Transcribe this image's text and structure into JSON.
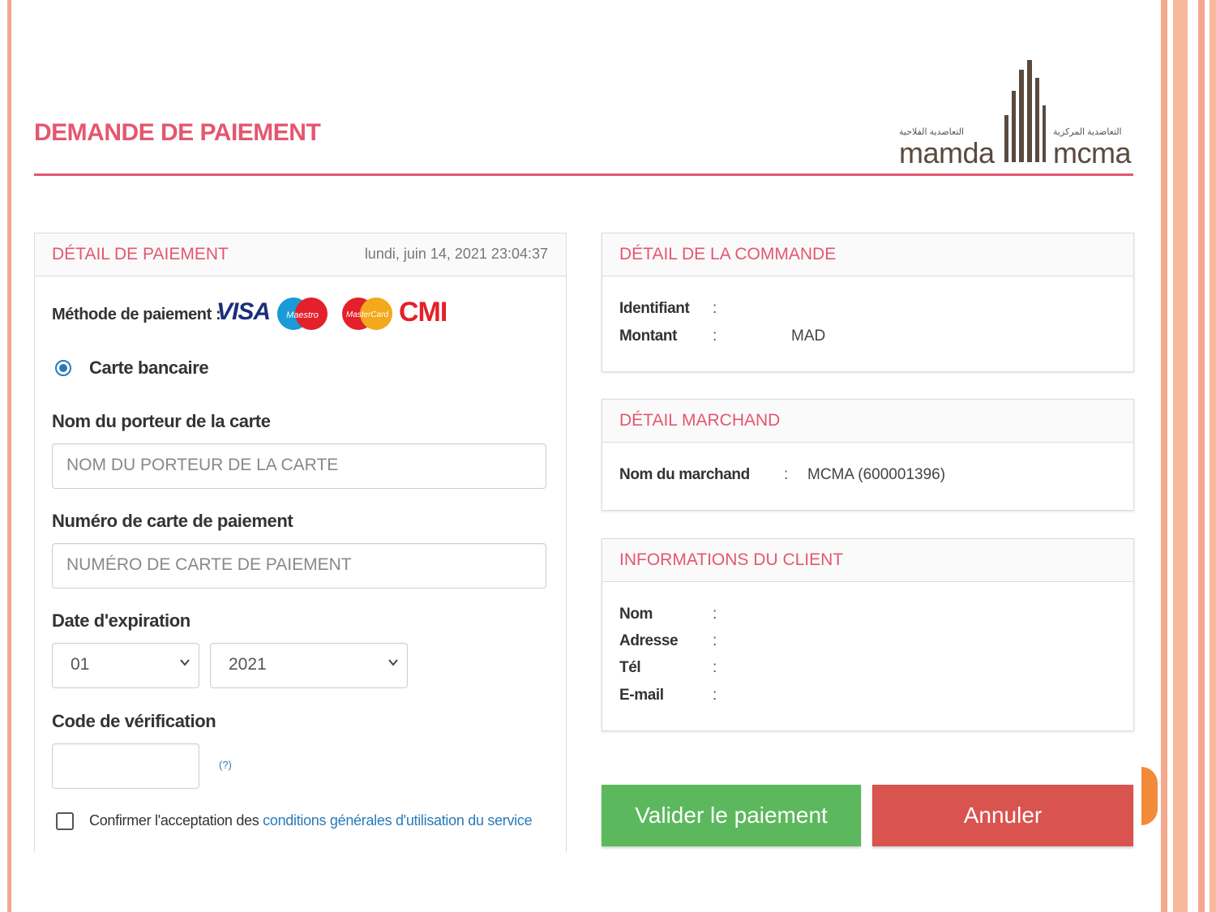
{
  "header": {
    "title": "DEMANDE DE PAIEMENT",
    "logo": {
      "left_word": "mamda",
      "right_word": "mcma",
      "left_arabic": "التعاضدية الفلاحية",
      "right_arabic": "التعاضدية المركزية"
    }
  },
  "payment_panel": {
    "title": "DÉTAIL DE PAIEMENT",
    "date": "lundi, juin 14, 2021 23:04:37",
    "method_label": "Méthode de paiement :",
    "brands": {
      "visa": "VISA",
      "maestro": "Maestro",
      "mastercard": "MasterCard",
      "cmi": "CMI"
    },
    "radio_label": "Carte bancaire",
    "holder_label": "Nom du porteur de la carte",
    "holder_placeholder": "NOM DU PORTEUR DE LA CARTE",
    "number_label": "Numéro de carte de paiement",
    "number_placeholder": "NUMÉRO DE CARTE DE PAIEMENT",
    "expiry_label": "Date d'expiration",
    "expiry_month": "01",
    "expiry_year": "2021",
    "cvv_label": "Code de vérification",
    "cvv_help": "(?)",
    "terms_prefix": "Confirmer l'acceptation des",
    "terms_link": "conditions générales d'utilisation du service"
  },
  "order_panel": {
    "title": "DÉTAIL DE LA COMMANDE",
    "id_label": "Identifiant",
    "amount_label": "Montant",
    "separator": ":",
    "currency": "MAD"
  },
  "merchant_panel": {
    "title": "DÉTAIL MARCHAND",
    "name_label": "Nom du marchand",
    "separator": ":",
    "name_value": "MCMA (600001396)"
  },
  "client_panel": {
    "title": "INFORMATIONS DU CLIENT",
    "name_label": "Nom",
    "address_label": "Adresse",
    "phone_label": "Tél",
    "email_label": "E-mail",
    "separator": ":"
  },
  "actions": {
    "submit": "Valider le paiement",
    "cancel": "Annuler"
  },
  "colors": {
    "accent": "#e4576f",
    "submit": "#5cb85c",
    "cancel": "#d9534f",
    "link": "#2a7ab8"
  }
}
